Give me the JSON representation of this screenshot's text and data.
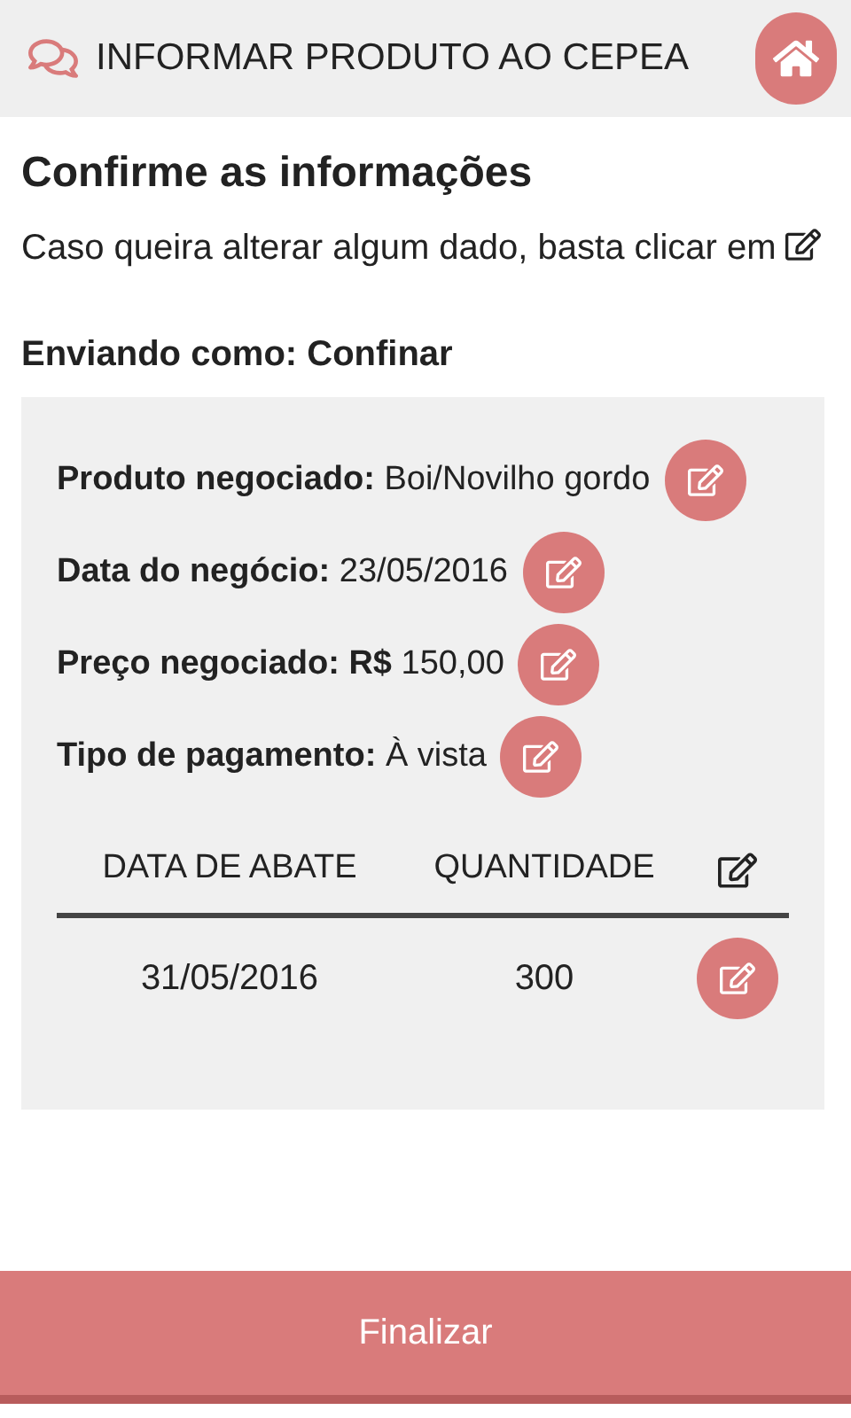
{
  "header": {
    "title": "INFORMAR PRODUTO AO CEPEA"
  },
  "heading": "Confirme as informações",
  "intro": "Caso queira alterar algum dado, basta clicar em",
  "sender": "Enviando como: Confinar",
  "fields": [
    {
      "text": "**Produto negociado:** Boi/Novilho gordo"
    },
    {
      "text": "**Data do negócio:** 23/05/2016"
    },
    {
      "text": "**Preço negociado: R$** 150,00"
    },
    {
      "text": "**Tipo de pagamento:** À vista"
    }
  ],
  "table": {
    "columns": [
      "DATA DE ABATE",
      "QUANTIDADE"
    ],
    "rows": [
      [
        "31/05/2016",
        "300"
      ]
    ]
  },
  "finish_button": "Finalizar"
}
